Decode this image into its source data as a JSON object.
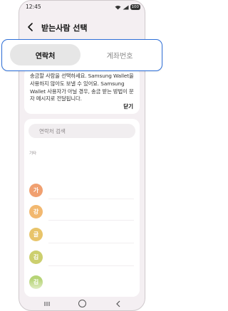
{
  "status_bar": {
    "time": "12:45",
    "battery": "100"
  },
  "header": {
    "title": "받는사람 선택"
  },
  "tabs": [
    {
      "label": "연락처",
      "selected": true
    },
    {
      "label": "계좌번호",
      "selected": false
    }
  ],
  "info": {
    "text": "송금할 사람을 선택하세요. Samsung Wallet을 사용하지 않아도 보낼 수 있어요. Samsung Wallet 사용자가 아닐 경우, 송금 받는 방법이 문자 메시지로 전달됩니다.",
    "close_label": "닫기"
  },
  "search": {
    "placeholder": "연락처 검색"
  },
  "contacts": {
    "section_label": "기타",
    "items": [
      {
        "initial": "가",
        "color": "#f0a070"
      },
      {
        "initial": "강",
        "color": "#f2b870"
      },
      {
        "initial": "글",
        "color": "#e8c46a"
      },
      {
        "initial": "김",
        "color": "#cccf6e"
      },
      {
        "initial": "김",
        "color": "#b6d476"
      }
    ]
  },
  "colors": {
    "accent": "#2e6fd8",
    "background": "#f4eff2"
  }
}
